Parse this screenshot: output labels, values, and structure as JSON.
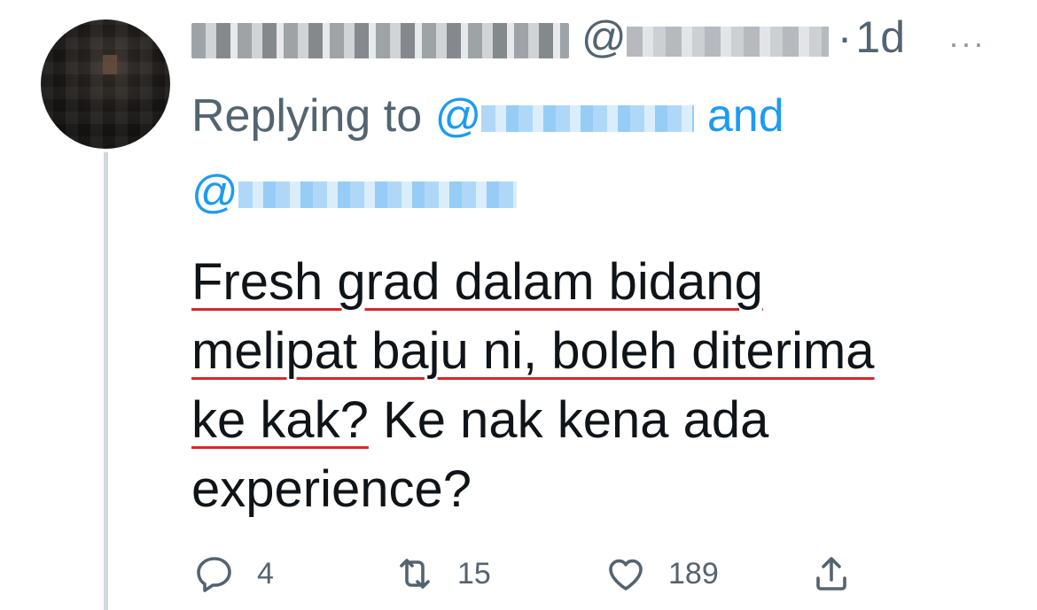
{
  "tweet": {
    "author": {
      "at_symbol": "@",
      "separator": "·",
      "time": "1d"
    },
    "reply": {
      "prefix": "Replying to",
      "at_symbol": "@",
      "conjunction": "and"
    },
    "body": {
      "line1": "Fresh grad dalam bidang",
      "line2": "melipat baju ni, boleh diterima",
      "line3_underlined": "ke kak?",
      "line3_rest": " Ke nak kena ada",
      "line4": "experience?"
    },
    "actions": {
      "reply_count": "4",
      "retweet_count": "15",
      "like_count": "189"
    },
    "more_label": "···"
  },
  "icons": {
    "reply": "reply-icon",
    "retweet": "retweet-icon",
    "like": "heart-icon",
    "share": "share-icon",
    "more": "more-icon"
  },
  "colors": {
    "text": "#0f1419",
    "secondary": "#536471",
    "link": "#1d9bf0",
    "underline": "#d6282b",
    "thread_line": "#cfd9de"
  }
}
